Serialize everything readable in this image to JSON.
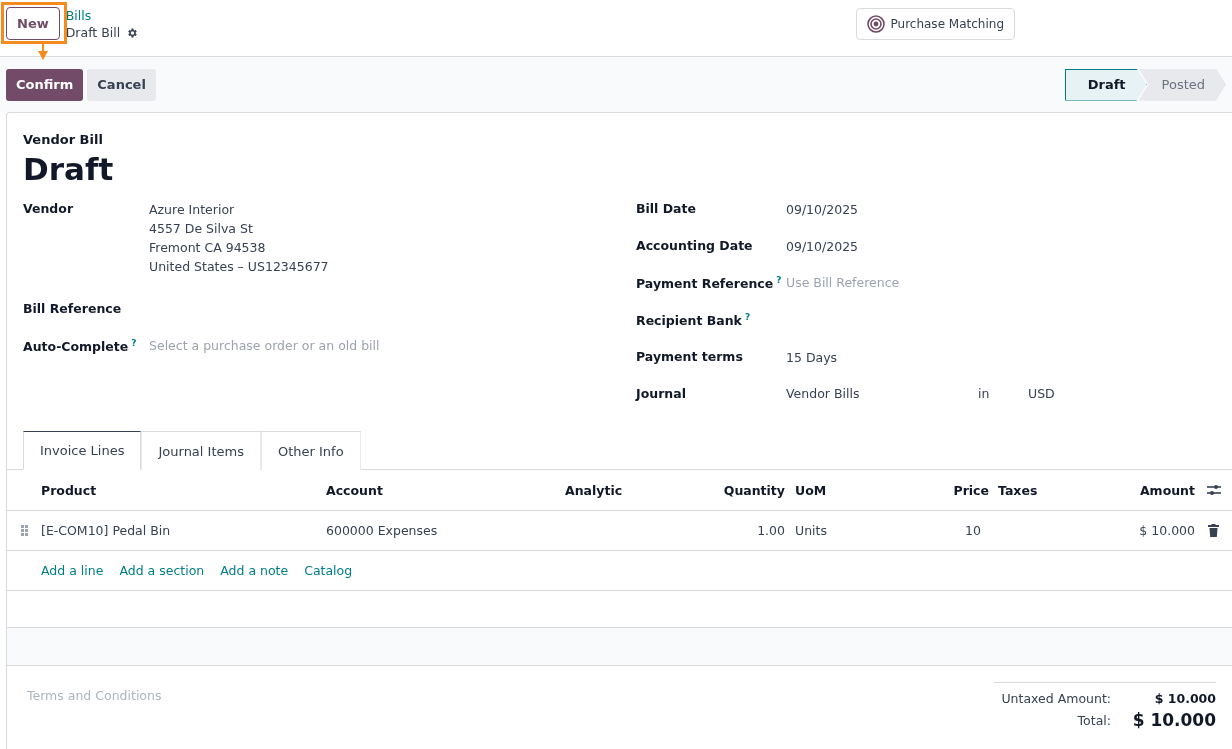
{
  "breadcrumb": {
    "parent": "Bills",
    "current": "Draft Bill"
  },
  "new_button": "New",
  "highlight": {
    "on": true
  },
  "smart_button": "Purchase Matching",
  "actions": [
    {
      "label": "Confirm",
      "kind": "primary"
    },
    {
      "label": "Cancel",
      "kind": "secondary"
    }
  ],
  "stages": [
    {
      "label": "Draft",
      "selected": true
    },
    {
      "label": "Posted",
      "selected": false
    }
  ],
  "form": {
    "type_label": "Vendor Bill",
    "title": "Draft",
    "left_fields": [
      {
        "label": "Vendor",
        "lines": [
          "Azure Interior",
          "4557 De Silva St",
          "Fremont CA 94538",
          "United States – US12345677"
        ]
      },
      {
        "label": "Bill Reference"
      },
      {
        "label": "Auto-Complete",
        "help": "?",
        "placeholder": "Select a purchase order or an old bill"
      }
    ],
    "right_fields": [
      {
        "label": "Bill Date",
        "value": "09/10/2025"
      },
      {
        "label": "Accounting Date",
        "value": "09/10/2025"
      },
      {
        "label": "Payment Reference",
        "help": "?",
        "placeholder": "Use Bill Reference"
      },
      {
        "label": "Recipient Bank",
        "help": "?"
      },
      {
        "label": "Payment terms",
        "value": "15 Days"
      },
      {
        "label": "Journal",
        "value": "Vendor Bills",
        "joiner": "in",
        "currency": "USD"
      }
    ]
  },
  "tabs": [
    {
      "label": "Invoice Lines",
      "selected": true
    },
    {
      "label": "Journal Items",
      "selected": false
    },
    {
      "label": "Other Info",
      "selected": false
    }
  ],
  "table": {
    "columns": [
      "Product",
      "Account",
      "Analytic",
      "Quantity",
      "UoM",
      "Price",
      "Taxes",
      "Amount"
    ],
    "rows": [
      {
        "product": "[E-COM10] Pedal Bin",
        "account": "600000 Expenses",
        "quantity": "1.00",
        "uom": "Units",
        "price": "10",
        "amount": "$ 10.000"
      }
    ],
    "add_links": [
      "Add a line",
      "Add a section",
      "Add a note",
      "Catalog"
    ]
  },
  "terms_placeholder": "Terms and Conditions",
  "totals": [
    {
      "label": "Untaxed Amount:",
      "value": "$ 10.000",
      "kind": "sub"
    },
    {
      "label": "Total:",
      "value": "$ 10.000",
      "kind": "grand"
    }
  ]
}
